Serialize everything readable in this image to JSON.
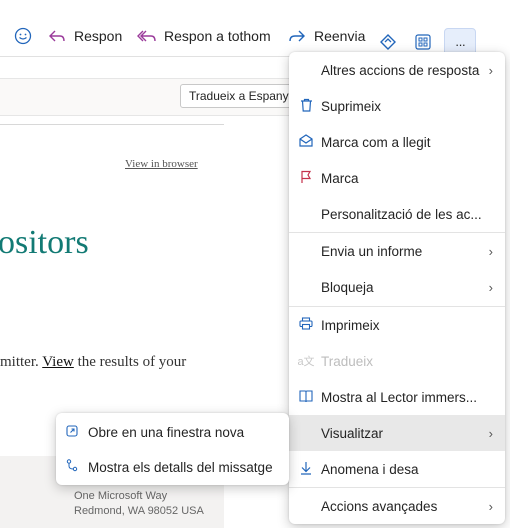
{
  "toolbar": {
    "reply_label": "Respon",
    "reply_all_label": "Respon a tothom",
    "forward_label": "Reenvia",
    "more_label": "···"
  },
  "translate": {
    "button_label": "Tradueix a Espanyol"
  },
  "email": {
    "view_in_browser": "View in browser",
    "heading_fragment": "ositors",
    "body_before": "mitter.",
    "body_link": "View",
    "body_after": "the results of your",
    "address_line1": "One Microsoft Way",
    "address_line2": "Redmond, WA 98052 USA"
  },
  "menu": {
    "items": [
      {
        "label": "Altres accions de resposta",
        "icon": "",
        "submenu": true,
        "disabled": false
      },
      {
        "label": "Suprimeix",
        "icon": "trash-icon",
        "submenu": false,
        "disabled": false
      },
      {
        "label": "Marca com a llegit",
        "icon": "envelope-open-icon",
        "submenu": false,
        "disabled": false
      },
      {
        "label": "Marca",
        "icon": "flag-icon",
        "submenu": false,
        "disabled": false
      },
      {
        "label": "Personalització de les ac...",
        "icon": "",
        "submenu": false,
        "disabled": false
      },
      {
        "label": "Envia un informe",
        "icon": "",
        "submenu": true,
        "disabled": false
      },
      {
        "label": "Bloqueja",
        "icon": "",
        "submenu": true,
        "disabled": false
      },
      {
        "label": "Imprimeix",
        "icon": "printer-icon",
        "submenu": false,
        "disabled": false
      },
      {
        "label": "Tradueix",
        "icon": "translate-icon",
        "submenu": false,
        "disabled": true
      },
      {
        "label": "Mostra al Lector immers...",
        "icon": "immersive-reader-icon",
        "submenu": false,
        "disabled": false
      },
      {
        "label": "Visualitzar",
        "icon": "",
        "submenu": true,
        "disabled": false,
        "active": true
      },
      {
        "label": "Anomena i desa",
        "icon": "download-icon",
        "submenu": false,
        "disabled": false
      },
      {
        "label": "Accions avançades",
        "icon": "",
        "submenu": true,
        "disabled": false
      }
    ]
  },
  "submenu": {
    "items": [
      {
        "label": "Obre en una finestra nova",
        "icon": "open-window-icon"
      },
      {
        "label": "Mostra els detalls del missatge",
        "icon": "message-details-icon"
      }
    ]
  }
}
